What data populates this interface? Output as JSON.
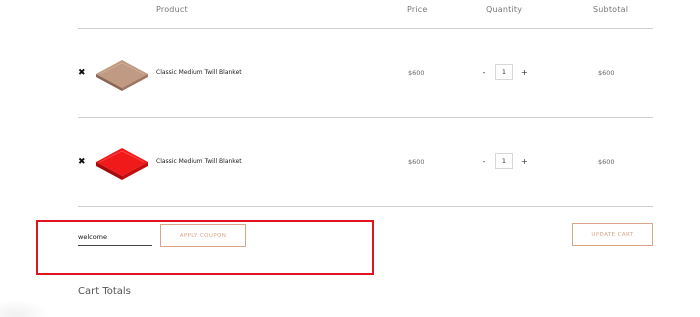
{
  "table_header": {
    "product": "Product",
    "price": "Price",
    "quantity": "Quantity",
    "subtotal": "Subtotal"
  },
  "items": [
    {
      "remove_icon": "✖",
      "thumbnail_icon": "folded-blanket-brown",
      "thumbnail_color": "#b58c73",
      "name": "Classic Medium Twill Blanket",
      "price": "$600",
      "qty_minus": "-",
      "qty": "1",
      "qty_plus": "+",
      "subtotal": "$600"
    },
    {
      "remove_icon": "✖",
      "thumbnail_icon": "folded-blanket-red",
      "thumbnail_color": "#e01212",
      "name": "Classic Medium Twill Blanket",
      "price": "$600",
      "qty_minus": "-",
      "qty": "1",
      "qty_plus": "+",
      "subtotal": "$600"
    }
  ],
  "coupon": {
    "value": "welcome",
    "apply_label": "APPLY COUPON",
    "highlight_color": "#e0141e"
  },
  "update_cart_label": "UPDATE CART",
  "cart_totals_title": "Cart Totals",
  "colors": {
    "button_accent": "#d9a58b",
    "divider": "#cfcfcf"
  }
}
